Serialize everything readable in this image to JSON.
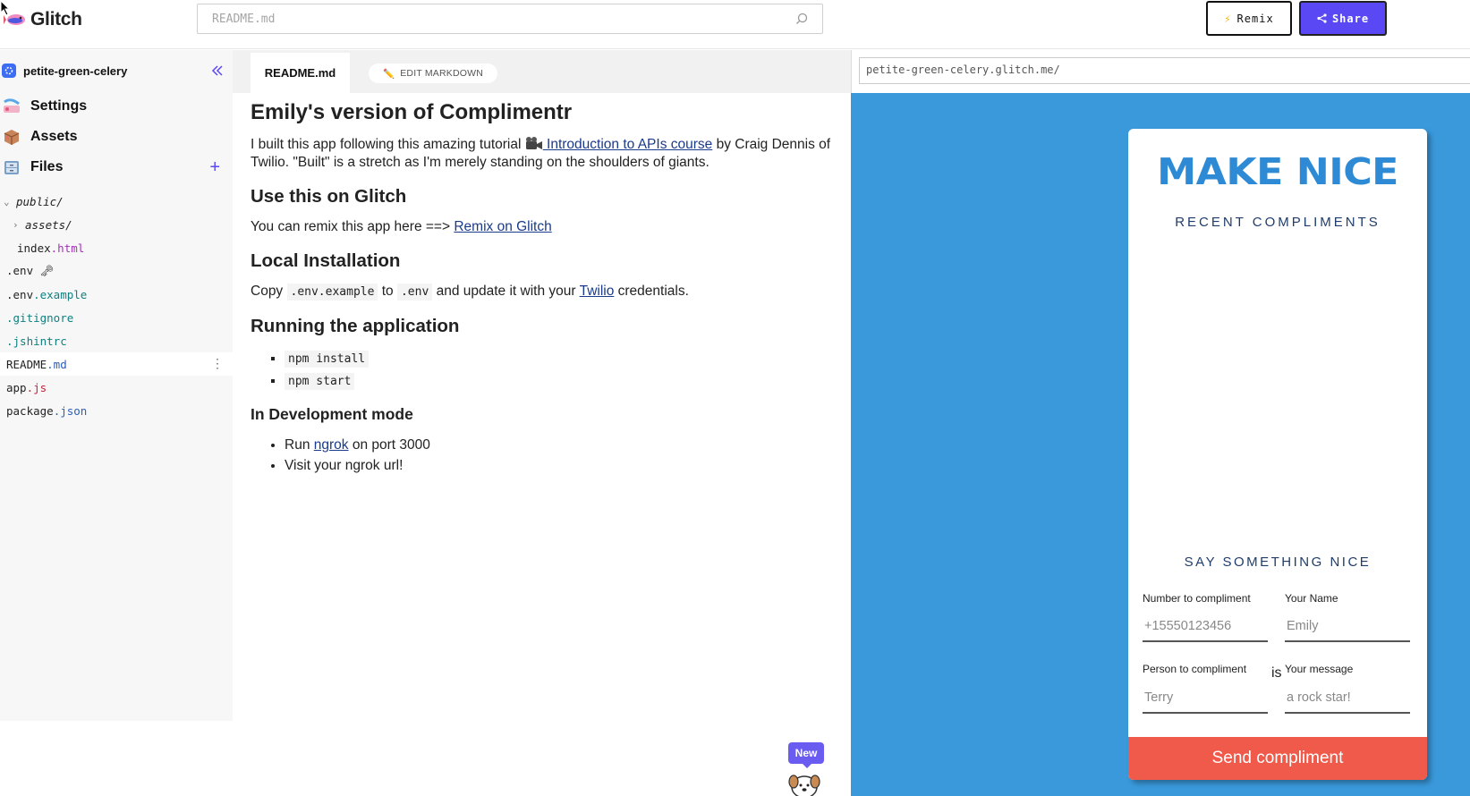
{
  "app": {
    "logo_text": "Glitch",
    "search_placeholder": "README.md",
    "remix_label": "Remix",
    "share_label": "Share"
  },
  "sidebar": {
    "project_name": "petite-green-celery",
    "nav": [
      {
        "label": "Settings",
        "icon": "settings-emoji-icon"
      },
      {
        "label": "Assets",
        "icon": "assets-box-icon"
      },
      {
        "label": "Files",
        "icon": "files-cabinet-icon"
      }
    ],
    "files": [
      {
        "base": "public/",
        "ext": "",
        "kind": "folder-open"
      },
      {
        "base": "assets/",
        "ext": "",
        "kind": "folder-closed"
      },
      {
        "base": "index",
        "ext": ".html"
      },
      {
        "base": ".env",
        "ext": "",
        "suffix": "🗝"
      },
      {
        "base": ".env",
        "ext": ".example"
      },
      {
        "base": "",
        "ext": ".gitignore"
      },
      {
        "base": "",
        "ext": ".jshintrc"
      },
      {
        "base": "README",
        "ext": ".md"
      },
      {
        "base": "app",
        "ext": ".js"
      },
      {
        "base": "package",
        "ext": ".json"
      }
    ]
  },
  "editor": {
    "active_tab": "README.md",
    "edit_button": "EDIT MARKDOWN"
  },
  "readme": {
    "title": "Emily's version of Complimentr",
    "intro_before": "I built this app following this amazing tutorial ",
    "intro_link": " Introduction to APIs course",
    "intro_after": " by Craig Dennis of Twilio. \"Built\" is a stretch as I'm merely standing on the shoulders of giants.",
    "h_use": "Use this on Glitch",
    "use_text": "You can remix this app here ==> ",
    "use_link": "Remix on Glitch",
    "h_local": "Local Installation",
    "local_1": "Copy ",
    "local_code1": ".env.example",
    "local_2": " to ",
    "local_code2": ".env",
    "local_3": " and update it with your ",
    "local_link": "Twilio",
    "local_4": " credentials.",
    "h_running": "Running the application",
    "running_items": [
      "npm install",
      "npm start"
    ],
    "h_dev": "In Development mode",
    "dev_1_a": "Run ",
    "dev_1_link": "ngrok",
    "dev_1_b": " on port 3000",
    "dev_2": "Visit your ngrok url!"
  },
  "new_badge": "New",
  "preview": {
    "url": "petite-green-celery.glitch.me/",
    "bg_color": "#3a99db",
    "heading": "MAKE NICE",
    "recent_label": "RECENT COMPLIMENTS",
    "say_label": "SAY SOMETHING NICE",
    "number_label": "Number to compliment",
    "number_placeholder": "+15550123456",
    "name_label": "Your Name",
    "name_placeholder": "Emily",
    "person_label": "Person to compliment",
    "person_placeholder": "Terry",
    "is_label": "is",
    "message_label": "Your message",
    "message_placeholder": "a rock star!",
    "send_label": "Send compliment",
    "send_color": "#ef5a4b"
  }
}
